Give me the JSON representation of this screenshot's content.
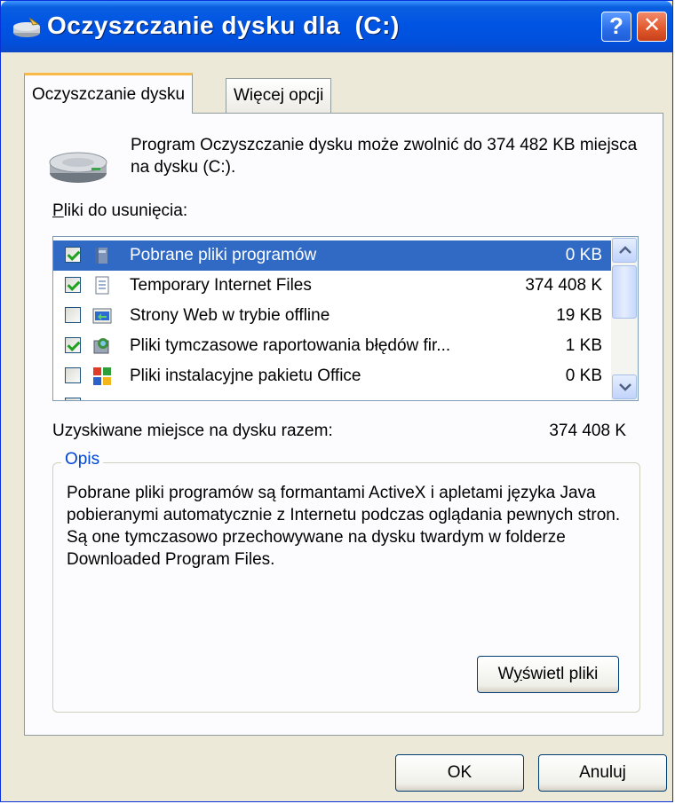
{
  "window": {
    "title": "Oczyszczanie dysku dla  (C:)",
    "help_button": "?",
    "close_button": "✕"
  },
  "tabs": [
    {
      "label": "Oczyszczanie dysku",
      "active": true
    },
    {
      "label": "Więcej opcji",
      "active": false
    }
  ],
  "info_text": "Program Oczyszczanie dysku może zwolnić do 374 482 KB miejsca na dysku  (C:).",
  "files_label_first": "P",
  "files_label_rest": "liki do usunięcia:",
  "files": [
    {
      "name": "Pobrane pliki programów",
      "size": "0 KB",
      "checked": true,
      "selected": true,
      "icon": "folder-program-icon"
    },
    {
      "name": "Temporary Internet Files",
      "size": "374 408 K",
      "checked": true,
      "selected": false,
      "icon": "document-icon"
    },
    {
      "name": "Strony Web w trybie offline",
      "size": "19 KB",
      "checked": false,
      "selected": false,
      "icon": "offline-web-icon"
    },
    {
      "name": "Pliki tymczasowe raportowania błędów fir...",
      "size": "1 KB",
      "checked": true,
      "selected": false,
      "icon": "error-report-icon"
    },
    {
      "name": "Pliki instalacyjne pakietu Office",
      "size": "0 KB",
      "checked": false,
      "selected": false,
      "icon": "office-icon"
    }
  ],
  "total_label": "Uzyskiwane miejsce na dysku razem:",
  "total_value": "374 408 K",
  "description": {
    "legend": "Opis",
    "text": "Pobrane pliki programów są formantami ActiveX i apletami języka Java pobieranymi automatycznie z Internetu podczas oglądania pewnych stron. Są one tymczasowo przechowywane na dysku twardym w folderze Downloaded Program Files."
  },
  "buttons": {
    "view_files_prefix": "W",
    "view_files_ul": "y",
    "view_files_rest": "świetl pliki",
    "ok": "OK",
    "cancel": "Anuluj"
  },
  "colors": {
    "title_bar": "#0054e3",
    "selection": "#316ac5",
    "dialog_bg": "#ece9d8",
    "group_legend": "#0046d5"
  }
}
